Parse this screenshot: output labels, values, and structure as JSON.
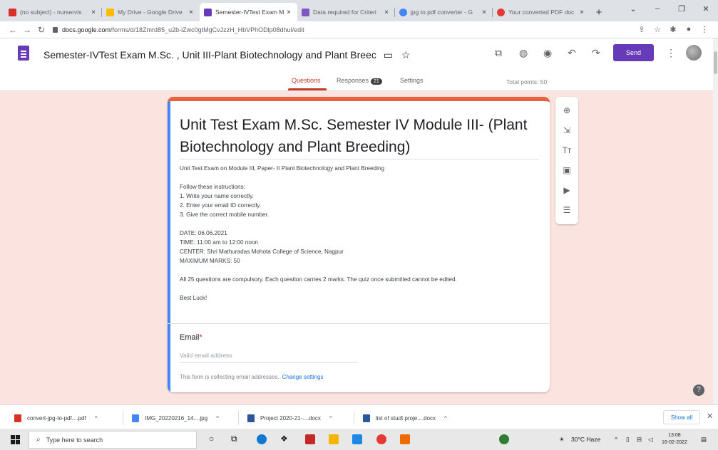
{
  "browser": {
    "tabs": [
      {
        "label": "(no subject) - nurservis",
        "icon_color": "#d93025",
        "icon": "gmail-icon"
      },
      {
        "label": "My Drive - Google Drive",
        "icon_color": "#fbbc04",
        "icon": "drive-icon"
      },
      {
        "label": "Semester-IVTest Exam M",
        "icon_color": "#673ab7",
        "icon": "forms-icon"
      },
      {
        "label": "Data required for Criteri",
        "icon_color": "#7e57c2",
        "icon": "forms-icon"
      },
      {
        "label": "jpg to pdf converter - G",
        "icon_color": "#4285f4",
        "icon": "google-icon"
      },
      {
        "label": "Your converted PDF doc",
        "icon_color": "#e53935",
        "icon": "pdf-icon"
      }
    ],
    "tab_close": "×",
    "new_tab": "+",
    "url_host": "docs.google.com",
    "url_path": "/forms/d/18Zmrd85_u2b-iZwc0gtMgCvJzzH_HbVPhODlp08dhul/edit"
  },
  "header": {
    "form_title": "Semester-IVTest Exam M.Sc. , Unit III-Plant Biotechnology and Plant Breec",
    "send_label": "Send",
    "icons": [
      "addon-icon",
      "palette-icon",
      "preview-icon",
      "undo-icon",
      "redo-icon"
    ]
  },
  "tabs": {
    "questions": "Questions",
    "responses": "Responses",
    "responses_count": "21",
    "settings": "Settings",
    "total_points": "Total points: 50"
  },
  "form": {
    "title": "Unit Test Exam M.Sc. Semester IV Module III- (Plant Biotechnology and Plant Breeding)",
    "subtitle": "Unit Test Exam on Module III, Paper- II Plant Biotechnology and Plant Breeding",
    "instructions_header": "Follow these instructions:",
    "instructions": [
      "1. Write your name correctly.",
      "2. Enter your email ID correctly.",
      "3. Give the correct mobile number."
    ],
    "details": [
      "DATE: 06.06.2021",
      "TIME: 11:00 am to 12:00 noon",
      "CENTER: Shri Mathuradas Mohota College of Science, Nagpur",
      "MAXIMUM MARKS: 50"
    ],
    "rules": "All 25 questions are compulsory. Each question carries 2 marks. The quiz once submitted cannot be edited.",
    "closing": "Best Luck!",
    "email_label": "Email",
    "email_required": "*",
    "email_placeholder": "Valid email address",
    "collect_note": "This form is collecting email addresses.",
    "change_settings": "Change settings"
  },
  "downloads": {
    "items": [
      {
        "label": "convert-jpg-to-pdf....pdf",
        "icon_color": "#d93025"
      },
      {
        "label": "IMG_20220216_14....jpg",
        "icon_color": "#4285f4"
      },
      {
        "label": "Project 2020-21-....docx",
        "icon_color": "#2b579a"
      },
      {
        "label": "list of studt proje....docx",
        "icon_color": "#2b579a"
      }
    ],
    "show_all": "Show all"
  },
  "taskbar": {
    "search_placeholder": "Type here to search",
    "weather": "30°C Haze",
    "time": "13:08",
    "date": "16-02-2022"
  }
}
